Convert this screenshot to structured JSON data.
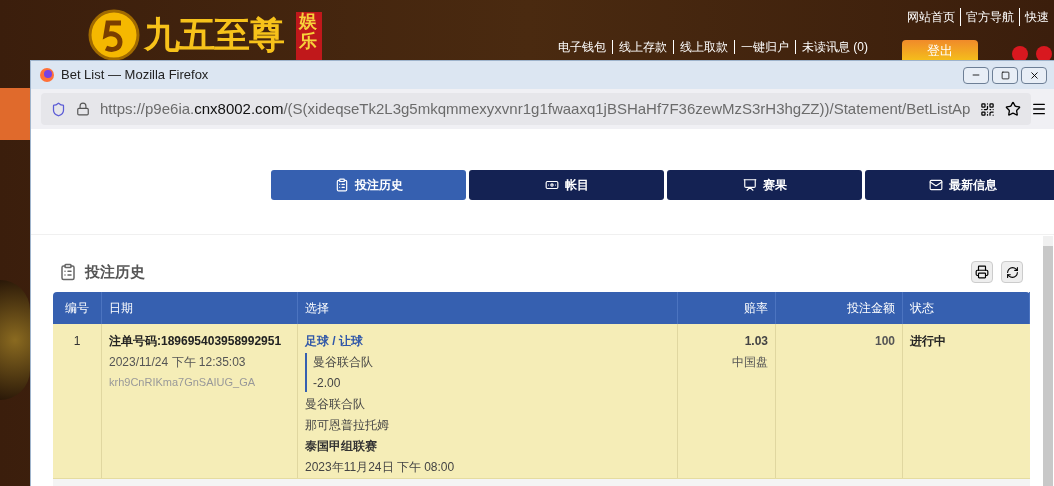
{
  "site": {
    "brand": "九五至尊",
    "badge": "娱乐",
    "top_links": [
      "网站首页",
      "官方导航",
      "快速"
    ],
    "nav_links": [
      "电子钱包",
      "线上存款",
      "线上取款",
      "一键归户",
      "未读讯息 (0)"
    ],
    "logout": "登出"
  },
  "window": {
    "title": "Bet List — Mozilla Firefox",
    "url_start": "https://p9e6ia.",
    "url_domain": "cnx8002.com",
    "url_path": "/(S(xideqseTk2L3g5mkqmmexyxvnr1g1fwaaxq1jBSHaHf7F36zewMzS3rH3hgZZ))/Statement/BetListAp"
  },
  "tabs": [
    {
      "label": "投注历史",
      "selected": true
    },
    {
      "label": "帐目",
      "selected": false
    },
    {
      "label": "赛果",
      "selected": false
    },
    {
      "label": "最新信息",
      "selected": false
    }
  ],
  "section_title": "投注历史",
  "table": {
    "columns": [
      "编号",
      "日期",
      "选择",
      "赔率",
      "投注金额",
      "状态"
    ],
    "rows": [
      {
        "no": "1",
        "ticket": "注单号码:189695403958992951",
        "time": "2023/11/24 下午 12:35:03",
        "code": "krh9CnRIKma7GnSAIUG_GA",
        "sport": "足球 / 让球",
        "pick": "曼谷联合队",
        "handicap": "-2.00",
        "home": "曼谷联合队",
        "away": "那可恩普拉托姆",
        "league": "泰国甲组联赛",
        "match_time": "2023年11月24日 下午 08:00",
        "odds": "1.03",
        "odds_type": "中国盘",
        "stake": "100",
        "status": "进行中"
      }
    ]
  }
}
